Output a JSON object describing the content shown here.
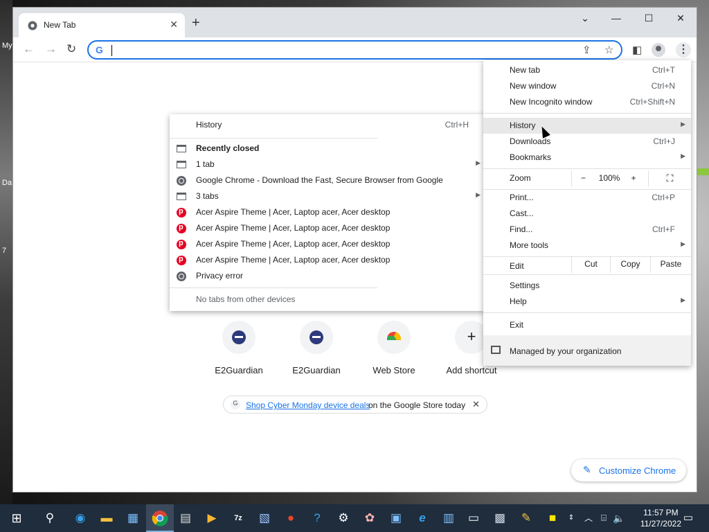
{
  "browser": {
    "tab_title": "New Tab",
    "omnibox_value": ""
  },
  "ntp": {
    "shortcuts": [
      {
        "label": "E2Guardian",
        "icon": "e2guardian-icon"
      },
      {
        "label": "E2Guardian",
        "icon": "e2guardian-icon"
      },
      {
        "label": "Web Store",
        "icon": "webstore-icon"
      },
      {
        "label": "Add shortcut",
        "icon": "plus-icon"
      }
    ],
    "promo": {
      "link": "Shop Cyber Monday device deals",
      "rest": "on the Google Store today"
    },
    "customize_label": "Customize Chrome"
  },
  "menu": {
    "items": [
      {
        "label": "New tab",
        "shortcut": "Ctrl+T"
      },
      {
        "label": "New window",
        "shortcut": "Ctrl+N"
      },
      {
        "label": "New Incognito window",
        "shortcut": "Ctrl+Shift+N"
      },
      {
        "label": "History",
        "shortcut": ""
      },
      {
        "label": "Downloads",
        "shortcut": "Ctrl+J"
      },
      {
        "label": "Bookmarks",
        "shortcut": ""
      },
      {
        "label": "Print...",
        "shortcut": "Ctrl+P"
      },
      {
        "label": "Cast...",
        "shortcut": ""
      },
      {
        "label": "Find...",
        "shortcut": "Ctrl+F"
      },
      {
        "label": "More tools",
        "shortcut": ""
      },
      {
        "label": "Settings",
        "shortcut": ""
      },
      {
        "label": "Help",
        "shortcut": ""
      },
      {
        "label": "Exit",
        "shortcut": ""
      }
    ],
    "zoom": {
      "label": "Zoom",
      "minus": "−",
      "value": "100%",
      "plus": "+"
    },
    "edit": {
      "label": "Edit",
      "cut": "Cut",
      "copy": "Copy",
      "paste": "Paste"
    },
    "managed": "Managed by your organization"
  },
  "history_submenu": {
    "header": {
      "label": "History",
      "shortcut": "Ctrl+H"
    },
    "recently_closed_label": "Recently closed",
    "items": [
      {
        "label": "1 tab",
        "icon": "tab-icon"
      },
      {
        "label": "Google Chrome - Download the Fast, Secure Browser from Google",
        "icon": "globe-icon"
      },
      {
        "label": "3 tabs",
        "icon": "tab-icon"
      },
      {
        "label": "Acer Aspire Theme | Acer, Laptop acer, Acer desktop",
        "icon": "pinterest-icon"
      },
      {
        "label": "Acer Aspire Theme | Acer, Laptop acer, Acer desktop",
        "icon": "pinterest-icon"
      },
      {
        "label": "Acer Aspire Theme | Acer, Laptop acer, Acer desktop",
        "icon": "pinterest-icon"
      },
      {
        "label": "Acer Aspire Theme | Acer, Laptop acer, Acer desktop",
        "icon": "pinterest-icon"
      },
      {
        "label": "Privacy error",
        "icon": "globe-icon"
      }
    ],
    "footer": "No tabs from other devices"
  },
  "desktop": {
    "left_glyphs": [
      "My",
      "Da",
      "7"
    ]
  },
  "taskbar": {
    "time": "11:57 PM",
    "date": "11/27/2022"
  },
  "colors": {
    "accent": "#1a73e8",
    "taskbar": "#1f2d3d",
    "menu_highlight": "#e8e8e8"
  }
}
